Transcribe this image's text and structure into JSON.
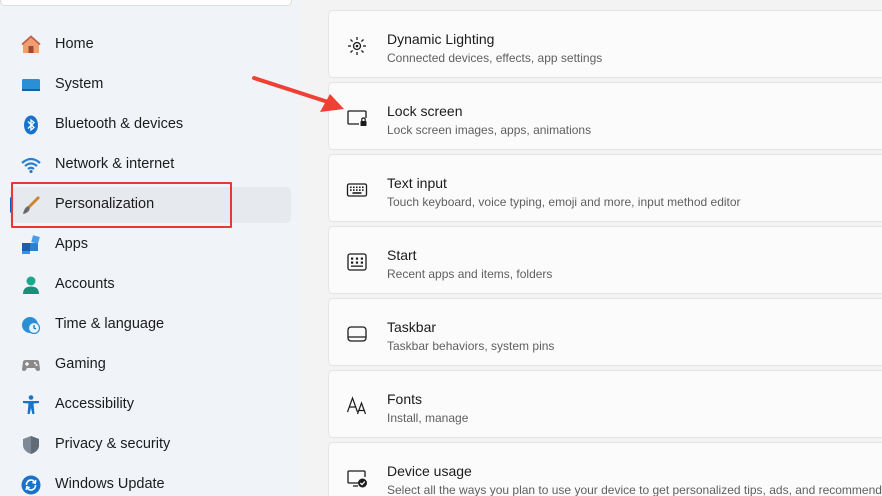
{
  "sidebar": {
    "items": [
      {
        "label": "Home",
        "icon": "home-icon"
      },
      {
        "label": "System",
        "icon": "system-icon"
      },
      {
        "label": "Bluetooth & devices",
        "icon": "bluetooth-icon"
      },
      {
        "label": "Network & internet",
        "icon": "wifi-icon"
      },
      {
        "label": "Personalization",
        "icon": "paintbrush-icon",
        "selected": true
      },
      {
        "label": "Apps",
        "icon": "apps-icon"
      },
      {
        "label": "Accounts",
        "icon": "accounts-icon"
      },
      {
        "label": "Time & language",
        "icon": "clock-globe-icon"
      },
      {
        "label": "Gaming",
        "icon": "gamepad-icon"
      },
      {
        "label": "Accessibility",
        "icon": "accessibility-icon"
      },
      {
        "label": "Privacy & security",
        "icon": "shield-icon"
      },
      {
        "label": "Windows Update",
        "icon": "update-icon"
      }
    ]
  },
  "main": {
    "cards": [
      {
        "title": "Dynamic Lighting",
        "subtitle": "Connected devices, effects, app settings",
        "icon": "dynamic-lighting-icon"
      },
      {
        "title": "Lock screen",
        "subtitle": "Lock screen images, apps, animations",
        "icon": "lock-screen-icon"
      },
      {
        "title": "Text input",
        "subtitle": "Touch keyboard, voice typing, emoji and more, input method editor",
        "icon": "keyboard-icon"
      },
      {
        "title": "Start",
        "subtitle": "Recent apps and items, folders",
        "icon": "start-icon"
      },
      {
        "title": "Taskbar",
        "subtitle": "Taskbar behaviors, system pins",
        "icon": "taskbar-icon"
      },
      {
        "title": "Fonts",
        "subtitle": "Install, manage",
        "icon": "fonts-icon"
      },
      {
        "title": "Device usage",
        "subtitle": "Select all the ways you plan to use your device to get personalized tips, ads, and recommendations",
        "icon": "device-usage-icon"
      }
    ]
  },
  "annotations": {
    "highlight_color": "#e53935",
    "arrow_color": "#ef4035",
    "accent_color": "#005fb8"
  }
}
